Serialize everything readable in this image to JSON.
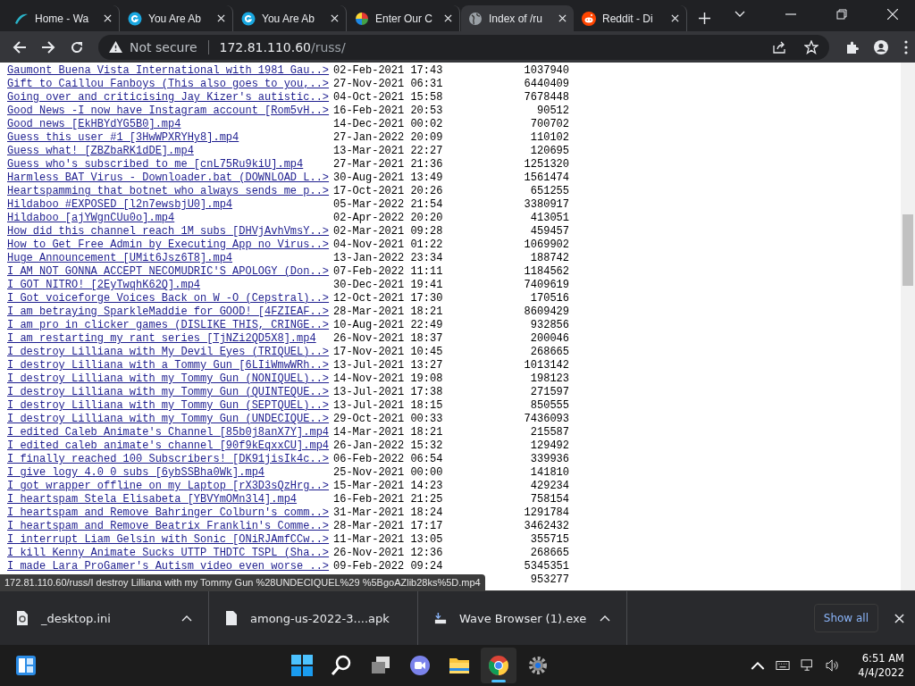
{
  "tabs": [
    {
      "title": "Home - Wa",
      "kind": "wave",
      "selected": false
    },
    {
      "title": "You Are Ab",
      "kind": "g",
      "selected": false
    },
    {
      "title": "You Are Ab",
      "kind": "g",
      "selected": false
    },
    {
      "title": "Enter Our C",
      "kind": "pinwheel",
      "selected": false
    },
    {
      "title": "Index of /ru",
      "kind": "globe",
      "selected": true
    },
    {
      "title": "Reddit - Di",
      "kind": "reddit",
      "selected": false
    }
  ],
  "address_bar": {
    "security": "Not secure",
    "host": "172.81.110.60",
    "path": "/russ/"
  },
  "listing": [
    {
      "name": "Gaumont Buena Vista International with 1981 Gau..>",
      "modified": "02-Feb-2021 17:43",
      "size": "1037940"
    },
    {
      "name": "Gift to Caillou Fanboys (This also goes to you,..>",
      "modified": "27-Nov-2021 06:31",
      "size": "6440409"
    },
    {
      "name": "Going over and criticising Jay Kizer's autistic..>",
      "modified": "04-Oct-2021 15:58",
      "size": "7678448"
    },
    {
      "name": "Good News -I now have Instagram account [Rom5vH..>",
      "modified": "16-Feb-2021 20:53",
      "size": "90512"
    },
    {
      "name": "Good news [EkHBYdYG5B0].mp4",
      "modified": "14-Dec-2021 00:02",
      "size": "700702"
    },
    {
      "name": "Guess this user #1 [3HwWPXRYHy8].mp4",
      "modified": "27-Jan-2022 20:09",
      "size": "110102"
    },
    {
      "name": "Guess what! [ZBZbaRK1dDE].mp4",
      "modified": "13-Mar-2021 22:27",
      "size": "120695"
    },
    {
      "name": "Guess who's subscribed to me [cnL75Ru9kiU].mp4",
      "modified": "27-Mar-2021 21:36",
      "size": "1251320"
    },
    {
      "name": "Harmless BAT Virus - Downloader.bat (DOWNLOAD L..>",
      "modified": "30-Aug-2021 13:49",
      "size": "1561474"
    },
    {
      "name": "Heartspamming that botnet who always sends me p..>",
      "modified": "17-Oct-2021 20:26",
      "size": "651255"
    },
    {
      "name": "Hildaboo #EXPOSED [l2n7ewsbjU0].mp4",
      "modified": "05-Mar-2022 21:54",
      "size": "3380917"
    },
    {
      "name": "Hildaboo [ajYWgnCUu0o].mp4",
      "modified": "02-Apr-2022 20:20",
      "size": "413051"
    },
    {
      "name": "How did this channel reach 1M subs [DHVjAvhVmsY..>",
      "modified": "02-Mar-2021 09:28",
      "size": "459457"
    },
    {
      "name": "How to Get Free Admin by Executing App no Virus..>",
      "modified": "04-Nov-2021 01:22",
      "size": "1069902"
    },
    {
      "name": "Huge Announcement [UMit6Jsz6T8].mp4",
      "modified": "13-Jan-2022 23:34",
      "size": "188742"
    },
    {
      "name": "I AM NOT GONNA ACCEPT NECOMUDRIC'S APOLOGY (Don..>",
      "modified": "07-Feb-2022 11:11",
      "size": "1184562"
    },
    {
      "name": "I GOT NITRO! [2EyTwqhK62Q].mp4",
      "modified": "30-Dec-2021 19:41",
      "size": "7409619"
    },
    {
      "name": "I Got voiceforge Voices Back on W -O (Cepstral)..>",
      "modified": "12-Oct-2021 17:30",
      "size": "170516"
    },
    {
      "name": "I am betraying SparkleMaddie for GOOD! [4FZIEAF..>",
      "modified": "28-Mar-2021 18:21",
      "size": "8609429"
    },
    {
      "name": "I am pro in clicker games (DISLIKE THIS, CRINGE..>",
      "modified": "10-Aug-2021 22:49",
      "size": "932856"
    },
    {
      "name": "I am restarting my rant series [TjNZi2QD5X8].mp4",
      "modified": "26-Nov-2021 18:37",
      "size": "200046"
    },
    {
      "name": "I destroy Lilliana with My Devil Eyes (TRIQUEL)..>",
      "modified": "17-Nov-2021 10:45",
      "size": "268665"
    },
    {
      "name": "I destroy Lilliana with a Tommy Gun [6LIiWmwWRh..>",
      "modified": "13-Jul-2021 13:27",
      "size": "1013142"
    },
    {
      "name": "I destroy Lilliana with my Tommy Gun (NONIQUEL)..>",
      "modified": "14-Nov-2021 19:08",
      "size": "198123"
    },
    {
      "name": "I destroy Lilliana with my Tommy Gun (QUINTEQUE..>",
      "modified": "13-Jul-2021 17:38",
      "size": "271597"
    },
    {
      "name": "I destroy Lilliana with my Tommy Gun (SEPTQUEL)..>",
      "modified": "13-Jul-2021 18:15",
      "size": "850555"
    },
    {
      "name": "I destroy Lilliana with my Tommy Gun (UNDECIQUE..>",
      "modified": "29-Oct-2021 00:33",
      "size": "7436093"
    },
    {
      "name": "I edited Caleb Animate's Channel [85b0j8anX7Y].mp4",
      "modified": "14-Mar-2021 18:21",
      "size": "215587"
    },
    {
      "name": "I edited caleb animate's channel [90f9kEqxxCU].mp4",
      "modified": "26-Jan-2022 15:32",
      "size": "129492"
    },
    {
      "name": "I finally reached 100 Subscribers! [DK91jisIk4c..>",
      "modified": "06-Feb-2022 06:54",
      "size": "339936"
    },
    {
      "name": "I give logy 4.0 0 subs [6ybSSBha0Wk].mp4",
      "modified": "25-Nov-2021 00:00",
      "size": "141810"
    },
    {
      "name": "I got wrapper offline on my Laptop [rX3D3sQzHrg..>",
      "modified": "15-Mar-2021 14:23",
      "size": "429234"
    },
    {
      "name": "I heartspam Stela Elisabeta [YBVYmOMn3l4].mp4",
      "modified": "16-Feb-2021 21:25",
      "size": "758154"
    },
    {
      "name": "I heartspam and Remove Bahringer Colburn's comm..>",
      "modified": "31-Mar-2021 18:24",
      "size": "1291784"
    },
    {
      "name": "I heartspam and Remove Beatrix Franklin's Comme..>",
      "modified": "28-Mar-2021 17:17",
      "size": "3462432"
    },
    {
      "name": "I interrupt Liam Gelsin with Sonic [ONiRJAmfCCw..>",
      "modified": "11-Mar-2021 13:05",
      "size": "355715"
    },
    {
      "name": "I kill Kenny Animate Sucks UTTP THDTC TSPL (Sha..>",
      "modified": "26-Nov-2021 12:36",
      "size": "268665"
    },
    {
      "name": "I made Lara ProGamer's Autism video even worse ..>",
      "modified": "09-Feb-2022 09:24",
      "size": "5345351"
    },
    {
      "size": "953277"
    }
  ],
  "status_url": "172.81.110.60/russ/I destroy Lilliana with my Tommy Gun %28UNDECIQUEL%29 %5BgoAZlib28ks%5D.mp4",
  "downloads": [
    {
      "file": "_desktop.ini",
      "kind": "settings-file"
    },
    {
      "file": "among-us-2022-3....apk",
      "kind": "file"
    },
    {
      "file": "Wave Browser (1).exe",
      "kind": "installer"
    }
  ],
  "show_all": "Show all",
  "taskbar": {
    "apps": [
      {
        "kind": "start",
        "running": false
      },
      {
        "kind": "search",
        "running": false
      },
      {
        "kind": "task-view",
        "running": false
      },
      {
        "kind": "chat",
        "running": false
      },
      {
        "kind": "folder",
        "running": false
      },
      {
        "kind": "chrome",
        "running": true
      },
      {
        "kind": "settings",
        "running": false
      }
    ],
    "time": "6:51 AM",
    "date": "4/4/2022"
  }
}
